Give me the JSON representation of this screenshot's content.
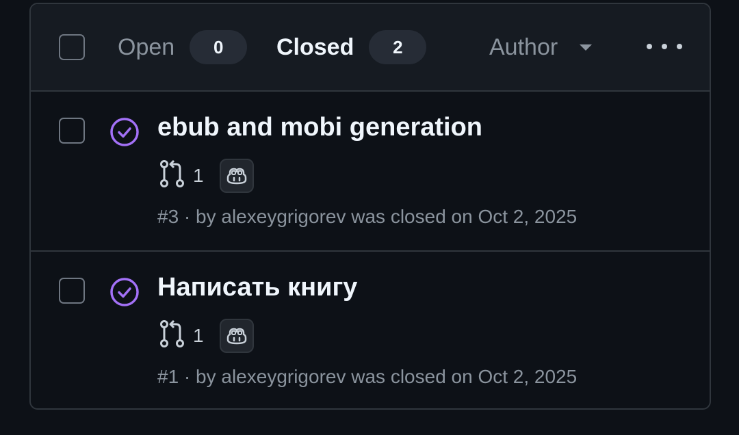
{
  "filters": {
    "open_label": "Open",
    "open_count": "0",
    "closed_label": "Closed",
    "closed_count": "2",
    "author_label": "Author"
  },
  "colors": {
    "closed_purple": "#a371f7",
    "background": "#0d1117",
    "header_bg": "#161b22",
    "border": "#30363d"
  },
  "issues": [
    {
      "title": "ebub and mobi generation",
      "linked_prs": "1",
      "meta": "#3 · by alexeygrigorev was closed on Oct 2, 2025",
      "status_icon": "closed-completed-icon",
      "pr_icon": "git-pull-request-icon",
      "badge_icon": "copilot-icon"
    },
    {
      "title": "Написать книгу",
      "linked_prs": "1",
      "meta": "#1 · by alexeygrigorev was closed on Oct 2, 2025",
      "status_icon": "closed-completed-icon",
      "pr_icon": "git-pull-request-icon",
      "badge_icon": "copilot-icon"
    }
  ]
}
